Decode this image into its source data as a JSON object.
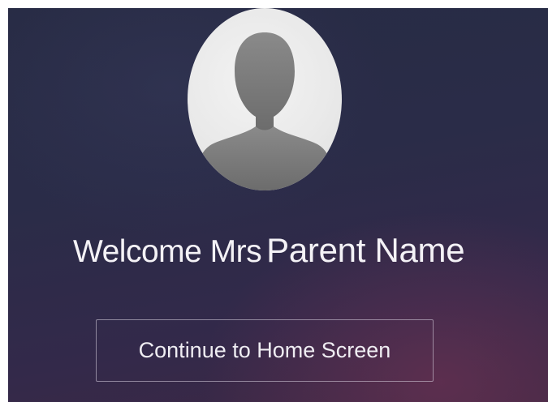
{
  "welcome": {
    "greeting": "Welcome Mrs",
    "name": "Parent Name"
  },
  "continue_button": {
    "label": "Continue to Home Screen"
  },
  "avatar": {
    "icon": "person-silhouette-icon"
  },
  "colors": {
    "background_top": "#272b44",
    "background_bottom_accent": "#783456",
    "text": "#f4f2f6",
    "avatar_bg": "#e9e9e9",
    "silhouette": "#7b7b7b"
  }
}
